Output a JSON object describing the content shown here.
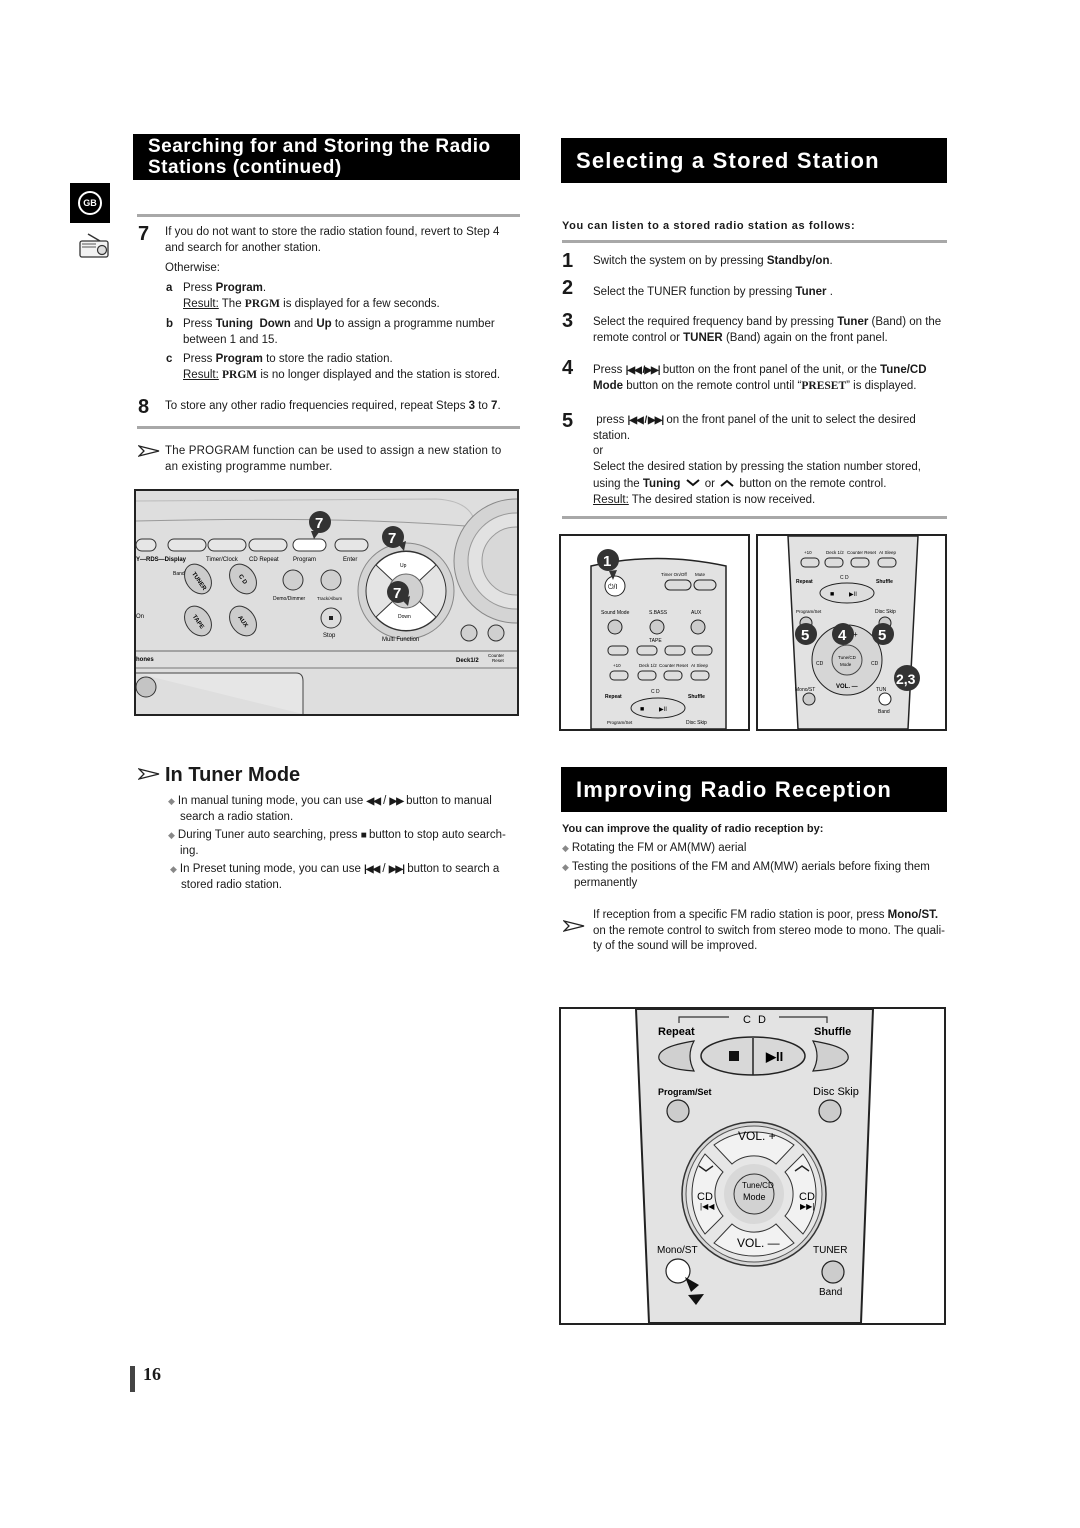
{
  "left": {
    "section_title_line1": "Searching for and Storing the Radio",
    "section_title_line2": "Stations (continued)",
    "lang_badge": "GB",
    "step7": {
      "num": "7",
      "text_a": "If you do not want to store the radio station found, revert to Step 4",
      "text_b": "and search for another station.",
      "otherwise": "Otherwise:",
      "sub_a": {
        "letter": "a",
        "pre": "Press ",
        "bold": "Program",
        "post": ".",
        "result_label": "Result:",
        "result_pre": " The ",
        "result_code": "PRGM",
        "result_post": " is displayed for a few seconds."
      },
      "sub_b": {
        "letter": "b",
        "pre": "Press ",
        "bold1": "Tuning  Down",
        "mid": " and ",
        "bold2": "Up",
        "post": " to assign a programme number",
        "line2": "between 1 and 15."
      },
      "sub_c": {
        "letter": "c",
        "pre": "Press ",
        "bold": "Program",
        "post": " to store the radio station.",
        "result_label": "Result:",
        "result_code": "PRGM",
        "result_post": " is no longer displayed and the station is stored."
      }
    },
    "step8": {
      "num": "8",
      "pre": "To store any other radio frequencies required, repeat Steps ",
      "b1": "3",
      "mid": " to ",
      "b2": "7",
      "post": "."
    },
    "note": {
      "line1": "The PROGRAM function can be used to assign a new station to",
      "line2": "an existing programme number."
    },
    "panel_figure": {
      "callouts": [
        "7",
        "7",
        "7"
      ],
      "labels": {
        "rds": "Y—RDS—Display",
        "timer": "Timer/Clock",
        "cd_repeat": "CD Repeat",
        "program": "Program",
        "enter": "Enter",
        "band": "Band",
        "tuner": "TUNER",
        "cd": "C D",
        "tape": "TAPE",
        "aux": "AUX",
        "demo": "Demo/Dimmer",
        "track": "Track/Album",
        "stop": "Stop",
        "up": "Up",
        "down": "Down",
        "multi": "Multi Function",
        "on": "On",
        "phones": "hones",
        "deck": "Deck1/2",
        "counter": "Counter",
        "reset": "Reset"
      }
    },
    "tuner_mode": {
      "title": "In Tuner Mode",
      "bullets": [
        {
          "pre": "In manual tuning mode, you can use ",
          "glyph1": "◀◀",
          "sep": " / ",
          "glyph2": "▶▶",
          "post": " button to manual",
          "line2": "search a radio station."
        },
        {
          "pre": "During Tuner auto searching, press ",
          "glyph1": "■",
          "post": " button to stop auto search-",
          "line2": "ing."
        },
        {
          "pre": "In Preset tuning mode, you can use ",
          "glyph1": "|◀◀",
          "sep": " / ",
          "glyph2": "▶▶|",
          "post": " button to search a",
          "line2": "stored radio station."
        }
      ]
    }
  },
  "right": {
    "section_title": "Selecting a Stored Station",
    "intro": "You can listen to a stored radio station as follows:",
    "steps": [
      {
        "num": "1",
        "pre": "Switch the system on by pressing ",
        "bold": "Standby/on",
        "post": "."
      },
      {
        "num": "2",
        "pre": "Select the TUNER function by pressing ",
        "bold": "Tuner",
        "post": " ."
      },
      {
        "num": "3",
        "pre": "Select the required frequency band by pressing ",
        "bold": "Tuner",
        "post": " (Band) on the",
        "line2_pre": "remote control or ",
        "line2_bold": "TUNER",
        "line2_post": " (Band) again on the front panel."
      },
      {
        "num": "4",
        "pre": "Press ",
        "glyph": "|◀◀ /▶▶|",
        "post": "  button on the front panel of the unit, or the ",
        "bold": "Tune/CD",
        "line2_bold": "Mode",
        "line2_pre": " button on the remote control until “",
        "line2_code": "PRESET",
        "line2_post": "” is displayed."
      },
      {
        "num": "5",
        "pre": " press ",
        "glyph": "|◀◀ / ▶▶|",
        "post": " on the front panel of the unit to select the desired",
        "line2": "station.",
        "line3": "or",
        "line4": "Select the desired station by pressing the station number stored,",
        "line5_pre": "using the ",
        "line5_bold": "Tuning",
        "line5_mid": " or ",
        "line5_post": " button on the remote control.",
        "result_label": "Result:",
        "result_post": " The desired station is now received."
      }
    ],
    "remote_fig_a": {
      "callout": "1",
      "labels": {
        "timer": "Timer On/Off",
        "mute": "Mute",
        "sound": "Sound Mode",
        "sbass": "S.BASS",
        "aux": "AUX",
        "tape": "TAPE",
        "p10": "+10",
        "deck": "Deck 1/2",
        "counter": "Counter Reset",
        "sleep": "AI Sleep",
        "cd": "C D",
        "repeat": "Repeat",
        "shuffle": "Shuffle",
        "program": "Program/Set",
        "disc": "Disc Skip"
      }
    },
    "remote_fig_b": {
      "callouts": [
        "5",
        "4",
        "5",
        "2,3"
      ],
      "labels": {
        "p10": "+10",
        "deck": "Deck 1/2",
        "counter": "Counter Reset",
        "sleep": "AI Sleep",
        "cd": "C D",
        "repeat": "Repeat",
        "shuffle": "Shuffle",
        "program": "Program/Set",
        "disc": "Disc Skip",
        "tune": "Tune/CD",
        "mode": "Mode",
        "cdl": "CD",
        "cdr": "CD",
        "vol_minus": "VOL. —",
        "plus": "+",
        "mono": "Mono/ST",
        "tuner": "TUN",
        "band": "Band"
      }
    },
    "reception": {
      "section_title": "Improving Radio Reception",
      "intro": "You can improve the quality of radio reception by:",
      "bullets": [
        "Rotating the FM or AM(MW) aerial",
        "Testing the positions of the FM and AM(MW) aerials before fixing them"
      ],
      "bullet2_line2": "permanently",
      "note": {
        "pre": "If reception from a specific FM radio station is poor, press ",
        "bold": "Mono/ST.",
        "line2": "on the remote control to switch from stereo mode to mono. The quali-",
        "line3": "ty of the sound will be improved."
      }
    },
    "remote_fig_c": {
      "labels": {
        "cd": "C D",
        "repeat": "Repeat",
        "shuffle": "Shuffle",
        "program": "Program/Set",
        "disc": "Disc Skip",
        "vol_plus": "VOL. +",
        "tune": "Tune/CD",
        "mode": "Mode",
        "cdl": "CD",
        "cdr": "CD",
        "vol_minus": "VOL. —",
        "mono": "Mono/ST",
        "tuner": "TUNER",
        "band": "Band"
      }
    }
  },
  "footer": {
    "page_number": "16"
  }
}
